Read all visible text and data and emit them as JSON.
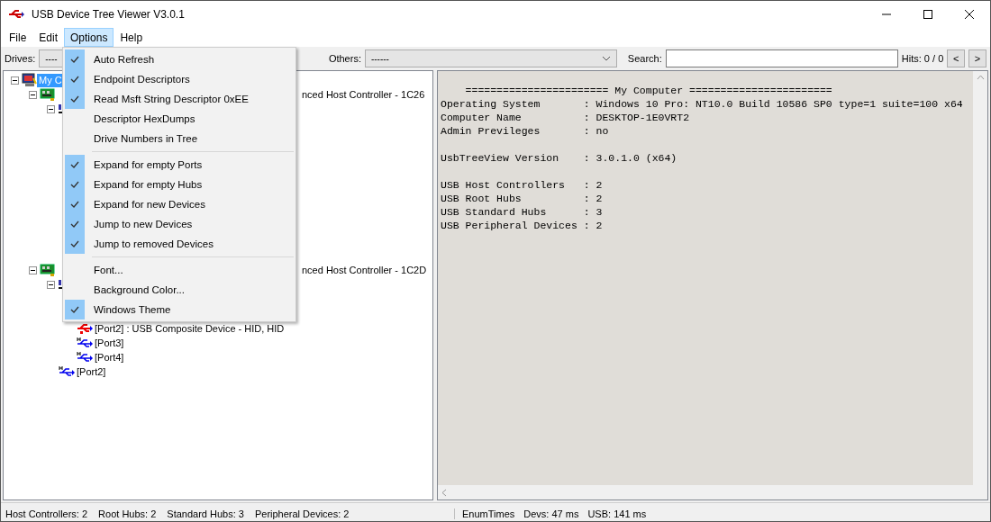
{
  "window": {
    "title": "USB Device Tree Viewer V3.0.1"
  },
  "menubar": [
    {
      "label": "File",
      "selected": false
    },
    {
      "label": "Edit",
      "selected": false
    },
    {
      "label": "Options",
      "selected": true
    },
    {
      "label": "Help",
      "selected": false
    }
  ],
  "toolbar": {
    "drives_label": "Drives:",
    "drives_value": "----",
    "others_label": "Others:",
    "others_value": "------",
    "search_label": "Search:",
    "hits": "Hits: 0 / 0",
    "prev": "<",
    "next": ">"
  },
  "tree": [
    {
      "kind": "computer",
      "label": "My C",
      "selected": true,
      "expanded": true,
      "children": [
        {
          "kind": "controller",
          "label": "nced Host Controller - 1C26",
          "selected": false,
          "expanded": true,
          "children": [
            {
              "kind": "hub",
              "selected": false,
              "expanded": true
            }
          ]
        },
        {
          "kind": "controller",
          "label": "nced Host Controller - 1C2D",
          "selected": false,
          "expanded": true,
          "children": [
            {
              "kind": "hub",
              "selected": false,
              "expanded": true,
              "children": [
                {
                  "kind": "device",
                  "label": "[Port2] : USB Composite Device - HID, HID",
                  "selected": false
                },
                {
                  "kind": "port",
                  "label": "[Port3]",
                  "selected": false
                },
                {
                  "kind": "port",
                  "label": "[Port4]",
                  "selected": false
                }
              ]
            },
            {
              "kind": "port",
              "label": "[Port2]",
              "selected": false
            }
          ]
        }
      ]
    }
  ],
  "menu": [
    {
      "kind": "item",
      "label": "Auto Refresh",
      "checked": true
    },
    {
      "kind": "item",
      "label": "Endpoint Descriptors",
      "checked": true
    },
    {
      "kind": "item",
      "label": "Read Msft String Descriptor 0xEE",
      "checked": true
    },
    {
      "kind": "item",
      "label": "Descriptor HexDumps",
      "checked": false
    },
    {
      "kind": "item",
      "label": "Drive Numbers in Tree",
      "checked": false
    },
    {
      "kind": "separator"
    },
    {
      "kind": "item",
      "label": "Expand for empty Ports",
      "checked": true
    },
    {
      "kind": "item",
      "label": "Expand for empty Hubs",
      "checked": true
    },
    {
      "kind": "item",
      "label": "Expand for new Devices",
      "checked": true
    },
    {
      "kind": "item",
      "label": "Jump to new Devices",
      "checked": true
    },
    {
      "kind": "item",
      "label": "Jump to removed Devices",
      "checked": true
    },
    {
      "kind": "separator"
    },
    {
      "kind": "item",
      "label": "Font...",
      "checked": false
    },
    {
      "kind": "item",
      "label": "Background Color...",
      "checked": false
    },
    {
      "kind": "item",
      "label": "Windows Theme",
      "checked": true
    }
  ],
  "details": [
    [
      "    ======================= My Computer =======================",
      "Operating System       : Windows 10 Pro: NT10.0 Build 10586 SP0 type=1 suite=100 x64",
      "Computer Name          : DESKTOP-1E0VRT2",
      "Admin Previleges       : no"
    ],
    [
      "UsbTreeView Version    : 3.0.1.0 (x64)"
    ],
    [
      "USB Host Controllers   : 2",
      "USB Root Hubs          : 2",
      "USB Standard Hubs      : 3",
      "USB Peripheral Devices : 2"
    ]
  ],
  "status_left": [
    "Host Controllers: 2",
    "Root Hubs: 2",
    "Standard Hubs: 3",
    "Peripheral Devices: 2"
  ],
  "status_right": [
    "EnumTimes",
    "Devs: 47 ms",
    "USB: 141 ms"
  ]
}
